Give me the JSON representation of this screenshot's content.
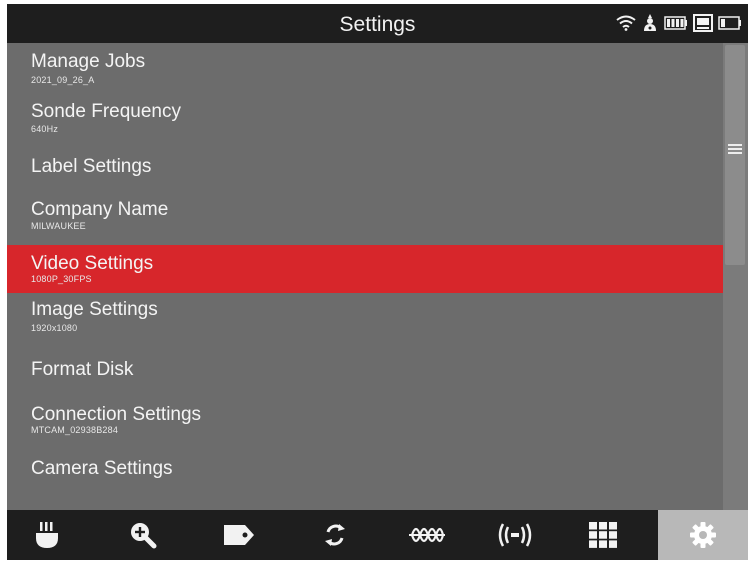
{
  "header": {
    "title": "Settings",
    "status_icons": [
      "wifi-icon",
      "person-lamp-icon",
      "battery-icon",
      "storage-icon",
      "battery-outline-icon"
    ]
  },
  "menu": {
    "items": [
      {
        "label": "Manage Jobs",
        "sub": "2021_09_26_A"
      },
      {
        "label": "Sonde Frequency",
        "sub": "640Hz"
      },
      {
        "label": "Label Settings",
        "sub": ""
      },
      {
        "label": "Company Name",
        "sub": "MILWAUKEE"
      },
      {
        "label": "Video Settings",
        "sub": "1080P_30FPS"
      },
      {
        "label": "Image Settings",
        "sub": "1920x1080"
      },
      {
        "label": "Format Disk",
        "sub": ""
      },
      {
        "label": "Connection Settings",
        "sub": "MTCAM_02938B284"
      },
      {
        "label": "Camera Settings",
        "sub": ""
      }
    ],
    "selected": "Video Settings"
  },
  "toolbar": {
    "buttons": [
      "camera-head-icon",
      "zoom-in-icon",
      "tag-icon",
      "rotate-icon",
      "waveform-icon",
      "sonde-icon",
      "grid-icon",
      "settings-gear-icon"
    ],
    "active": "settings-gear-icon"
  },
  "colors": {
    "background": "#6c6c6c",
    "title_bar": "#1e1e1e",
    "selected": "#d7262b",
    "toolbar_active": "#b8b8b8"
  }
}
